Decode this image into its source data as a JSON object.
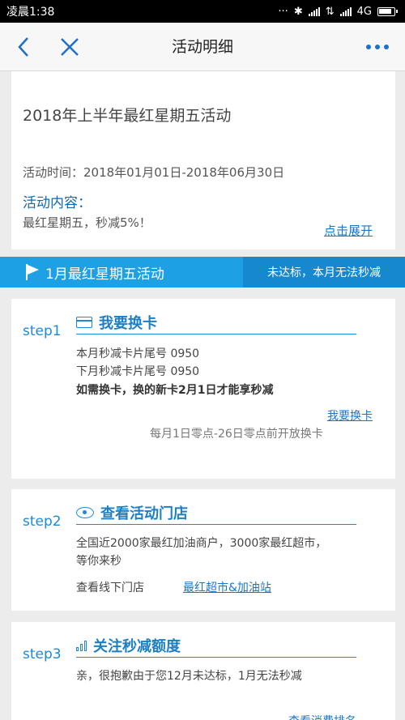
{
  "status_bar": {
    "time": "凌晨1:38",
    "network": "4G"
  },
  "nav": {
    "title": "活动明细",
    "back_icon": "chevron-left-icon",
    "close_icon": "close-icon",
    "more_icon": "more-dots-icon"
  },
  "info": {
    "title": "2018年上半年最红星期五活动",
    "time": "活动时间：2018年01月01日-2018年06月30日",
    "content_label": "活动内容：",
    "content_text": "最红星期五，秒减5%！",
    "expand_link": "点击展开"
  },
  "banner": {
    "title": "1月最红星期五活动",
    "status": "未达标，本月无法秒减",
    "color": "#1ea0e5"
  },
  "step1": {
    "label": "step1",
    "title": "我要换卡",
    "line1": "本月秒减卡片尾号 0950",
    "line2": "下月秒减卡片尾号 0950",
    "line3": "如需换卡，换的新卡2月1日才能享秒减",
    "link": "我要换卡",
    "note": "每月1日零点-26日零点前开放换卡"
  },
  "step2": {
    "label": "step2",
    "title": "查看活动门店",
    "line1": "全国近2000家最红加油商户，3000家最红超市，",
    "line2": "等你来秒",
    "offline": "查看线下门店",
    "link": "最红超市&加油站"
  },
  "step3": {
    "label": "step3",
    "title": "关注秒减额度",
    "line1": "亲，很抱歉由于您12月未达标，1月无法秒减",
    "link": "查看消费排名"
  },
  "accent": "#1d8ad6"
}
